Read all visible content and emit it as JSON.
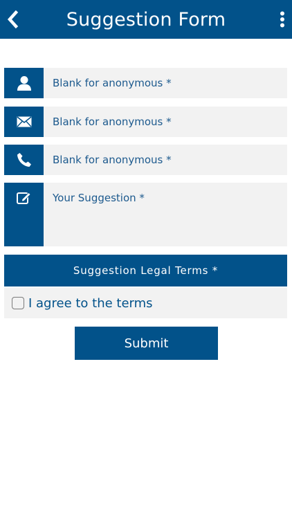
{
  "header": {
    "title": "Suggestion Form",
    "back_icon": "chevron-left-icon",
    "menu_icon": "more-vertical-icon"
  },
  "form": {
    "name": {
      "placeholder": "Blank for anonymous *",
      "icon": "user-icon"
    },
    "email": {
      "placeholder": "Blank for anonymous *",
      "icon": "envelope-icon"
    },
    "phone": {
      "placeholder": "Blank for anonymous *",
      "icon": "phone-icon"
    },
    "suggestion": {
      "placeholder": "Your Suggestion *",
      "icon": "edit-icon"
    }
  },
  "terms": {
    "header": "Suggestion Legal Terms *",
    "agree_label": "I agree to the terms",
    "checked": false
  },
  "submit_label": "Submit",
  "colors": {
    "primary": "#02528a",
    "field_bg": "#f2f2f2",
    "text": "#1d5a8e"
  }
}
